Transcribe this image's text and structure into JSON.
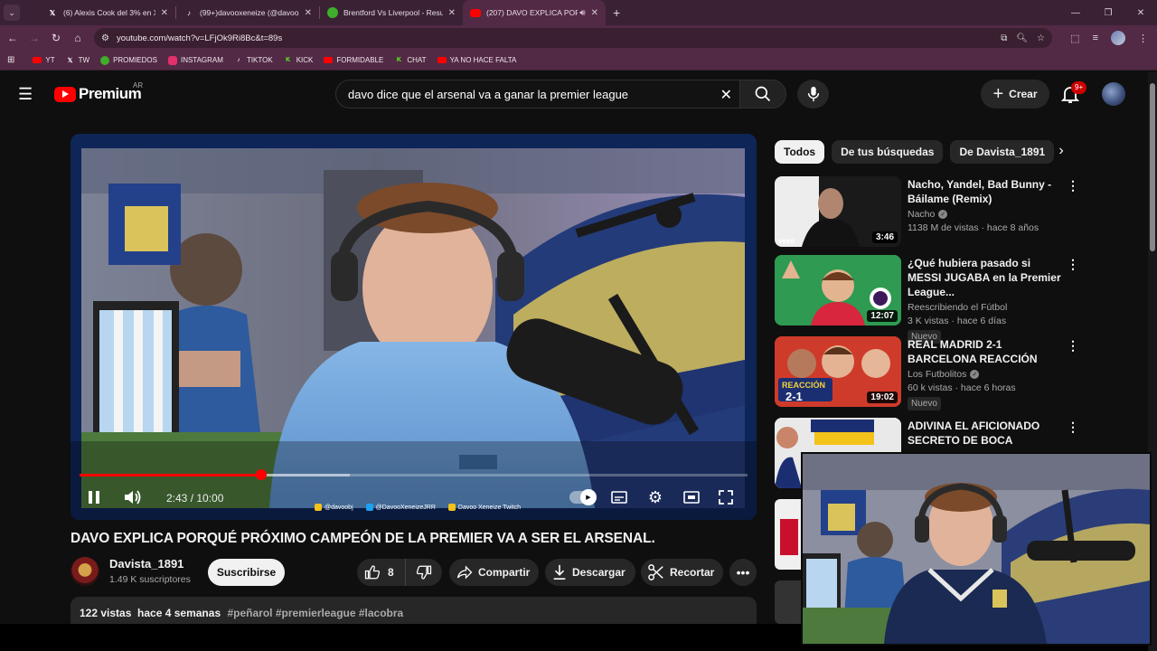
{
  "browser": {
    "tabs": [
      {
        "title": "(6) Alexis Cook del 3% en X: \"@",
        "favicon": "x-icon",
        "active": false
      },
      {
        "title": "(99+)davooxeneize (@davooxen",
        "favicon": "tiktok-icon",
        "active": false
      },
      {
        "title": "Brentford Vs Liverpool - Result",
        "favicon": "promiedos-icon",
        "active": false
      },
      {
        "title": "(207) DAVO EXPLICA PORQ",
        "favicon": "youtube-icon",
        "active": true
      }
    ],
    "url": "youtube.com/watch?v=LFjOk9Ri8Bc&t=89s",
    "bookmarks": [
      {
        "label": "YT",
        "icon": "youtube-icon",
        "color": "#ff0000"
      },
      {
        "label": "TW",
        "icon": "x-icon",
        "color": "#ffffff"
      },
      {
        "label": "PROMIEDOS",
        "icon": "promiedos-icon",
        "color": "#3fae2a"
      },
      {
        "label": "INSTAGRAM",
        "icon": "instagram-icon",
        "color": "#e1306c"
      },
      {
        "label": "TIKTOK",
        "icon": "tiktok-icon",
        "color": "#ffffff"
      },
      {
        "label": "KICK",
        "icon": "kick-icon",
        "color": "#53fc18"
      },
      {
        "label": "FORMIDABLE",
        "icon": "youtube-icon",
        "color": "#ff0000"
      },
      {
        "label": "CHAT",
        "icon": "kick-icon",
        "color": "#53fc18"
      },
      {
        "label": "YA NO HACE FALTA",
        "icon": "youtube-icon",
        "color": "#ff0000"
      }
    ]
  },
  "header": {
    "brand": "Premium",
    "country": "AR",
    "search_query": "davo dice que el arsenal va a ganar la premier league",
    "create_label": "Crear",
    "notifications": "9+"
  },
  "player": {
    "time_current": "2:43",
    "time_separator": " / ",
    "time_total": "10:00",
    "progress": 0.272,
    "buffered": 0.405,
    "overlay_social": [
      "@davoobj",
      "@DavooXeneizeJRR",
      "Davoo Xeneize Twitch"
    ],
    "colors": {
      "accent": "#ff0000"
    }
  },
  "video": {
    "title": "DAVO EXPLICA PORQUÉ PRÓXIMO CAMPEÓN DE LA PREMIER VA A SER EL ARSENAL.",
    "channel": "Davista_1891",
    "subscribers": "1.49 K suscriptores",
    "subscribe_label": "Suscribirse",
    "likes": "8",
    "share_label": "Compartir",
    "download_label": "Descargar",
    "clip_label": "Recortar",
    "views_date": "122 vistas  hace 4 semanas",
    "hashtags": "#peñarol #premierleague #lacobra"
  },
  "sidebar": {
    "chips": [
      "Todos",
      "De tus búsquedas",
      "De Davista_1891"
    ],
    "recommendations": [
      {
        "title": "Nacho, Yandel, Bad Bunny - Báilame (Remix)",
        "channel": "Nacho",
        "verified": true,
        "meta": "1138 M de vistas · hace 8 años",
        "duration": "3:46",
        "badge": ""
      },
      {
        "title": "¿Qué hubiera pasado si MESSI JUGABA en la Premier League...",
        "channel": "Reescribiendo el Fútbol",
        "verified": false,
        "meta": "3 K vistas · hace 6 días",
        "duration": "12:07",
        "badge": "Nuevo"
      },
      {
        "title": "REAL MADRID 2-1 BARCELONA REACCIÓN",
        "channel": "Los Futbolitos",
        "verified": true,
        "meta": "60 k vistas · hace 6 horas",
        "duration": "19:02",
        "badge": "Nuevo"
      },
      {
        "title": "ADIVINA EL AFICIONADO SECRETO DE BOCA",
        "channel": "",
        "verified": false,
        "meta": "",
        "duration": "",
        "badge": ""
      }
    ]
  }
}
